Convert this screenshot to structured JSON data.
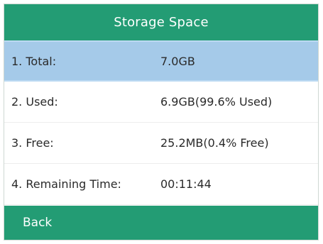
{
  "title": "Storage Space",
  "rows": [
    {
      "label": "1. Total:",
      "value": "7.0GB"
    },
    {
      "label": "2. Used:",
      "value": "6.9GB(99.6% Used)"
    },
    {
      "label": "3. Free:",
      "value": "25.2MB(0.4% Free)"
    },
    {
      "label": "4. Remaining Time:",
      "value": "00:11:44"
    }
  ],
  "softkeys": {
    "back_label": "Back"
  },
  "colors": {
    "accent": "#239c74",
    "selection": "#a5cae9"
  }
}
